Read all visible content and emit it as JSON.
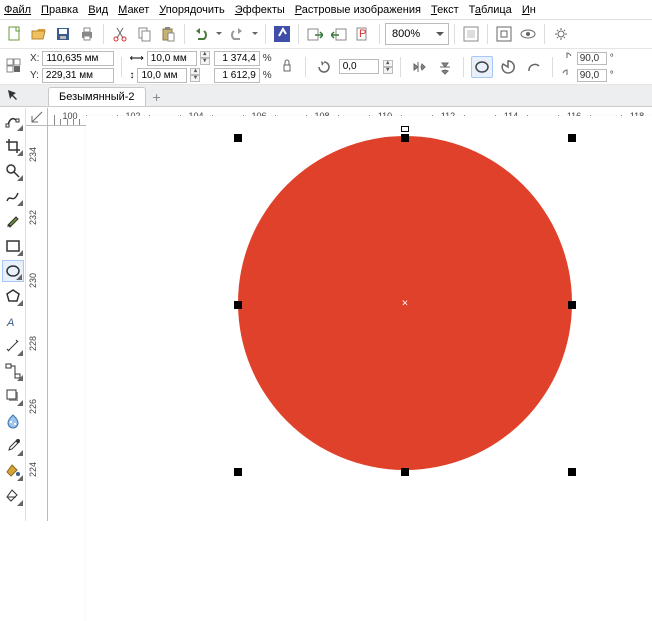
{
  "menu": [
    "Файл",
    "Правка",
    "Вид",
    "Макет",
    "Упорядочить",
    "Эффекты",
    "Растровые изображения",
    "Текст",
    "Таблица",
    "Ин"
  ],
  "menu_underline_idx": [
    0,
    0,
    0,
    0,
    0,
    0,
    0,
    0,
    1,
    0
  ],
  "toolbar1": {
    "zoom": "800%"
  },
  "props": {
    "x_label": "X:",
    "x": "110,635 мм",
    "y_label": "Y:",
    "y": "229,31 мм",
    "w": "10,0 мм",
    "h": "10,0 мм",
    "sx": "1 374,4",
    "sy": "1 612,9",
    "pct": "%",
    "ang": "0,0",
    "rot1": "90,0",
    "rot2": "90,0",
    "deg": "°"
  },
  "tab": "Безымянный-2",
  "ruler_h": [
    "100",
    "102",
    "104",
    "106",
    "108",
    "110",
    "112",
    "114",
    "116",
    "118"
  ],
  "ruler_v": [
    "234",
    "232",
    "230",
    "228",
    "226",
    "224"
  ],
  "colors": {
    "circle": "#e0412a"
  }
}
